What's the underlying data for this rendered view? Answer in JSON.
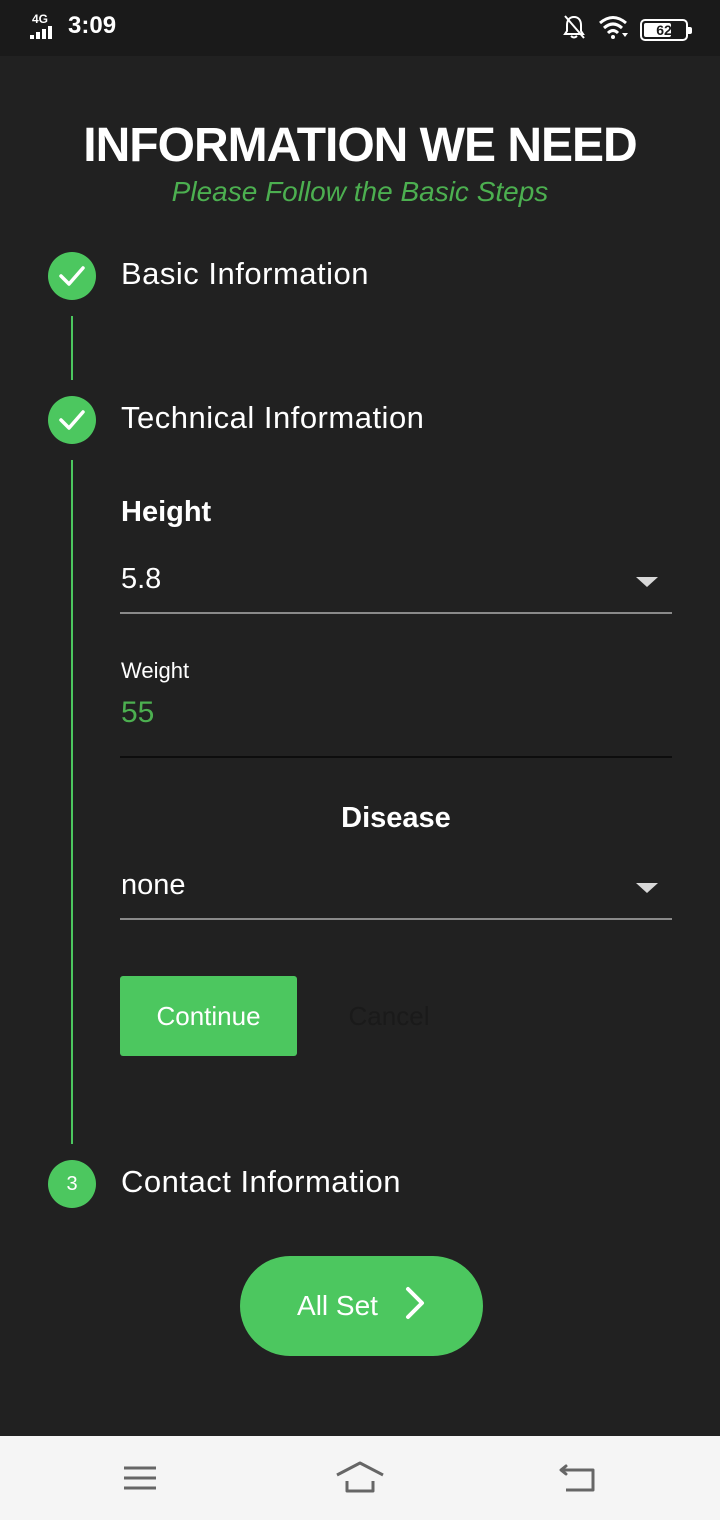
{
  "status_bar": {
    "network": "4G",
    "time": "3:09",
    "battery": "62",
    "icons": [
      "signal-icon",
      "bell-off-icon",
      "wifi-icon",
      "battery-icon"
    ]
  },
  "header": {
    "title": "INFORMATION WE NEED",
    "subtitle": "Please Follow the Basic Steps"
  },
  "stepper": {
    "steps": [
      {
        "label": "Basic Information",
        "state": "completed",
        "icon": "check-icon"
      },
      {
        "label": "Technical Information",
        "state": "completed",
        "icon": "check-icon"
      },
      {
        "label": "Contact Information",
        "state": "pending",
        "number": "3"
      }
    ]
  },
  "form": {
    "height": {
      "label": "Height",
      "value": "5.8"
    },
    "weight": {
      "label": "Weight",
      "value": "55"
    },
    "disease": {
      "label": "Disease",
      "value": "none"
    },
    "continue_label": "Continue",
    "cancel_label": "Cancel"
  },
  "all_set": {
    "label": "All Set",
    "icon": "chevron-right-icon"
  },
  "nav": {
    "icons": [
      "menu-icon",
      "home-icon",
      "back-icon"
    ]
  },
  "colors": {
    "accent": "#4cc75f",
    "subtitle": "#4caf50",
    "background": "#212121",
    "statusbar": "#1a1a1a",
    "navbar": "#f5f5f5"
  }
}
